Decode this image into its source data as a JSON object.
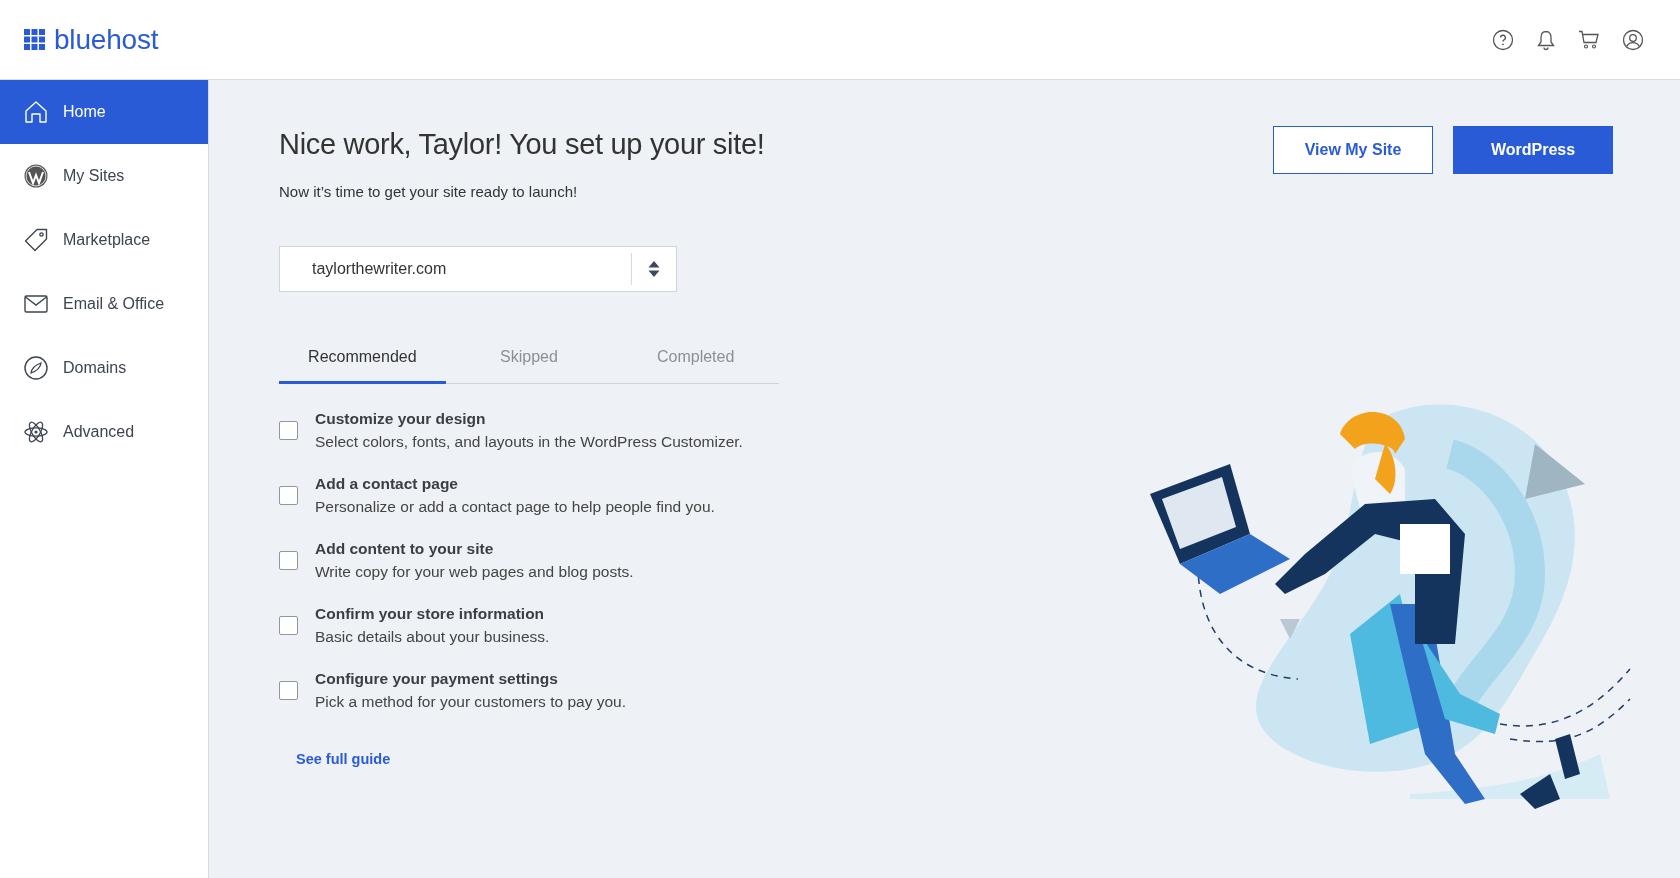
{
  "header": {
    "logo": "bluehost"
  },
  "sidebar": {
    "items": [
      {
        "label": "Home",
        "selected": true
      },
      {
        "label": "My Sites",
        "selected": false
      },
      {
        "label": "Marketplace",
        "selected": false
      },
      {
        "label": "Email & Office",
        "selected": false
      },
      {
        "label": "Domains",
        "selected": false
      },
      {
        "label": "Advanced",
        "selected": false
      }
    ]
  },
  "main": {
    "title": "Nice work, Taylor! You set up your site!",
    "subtitle": "Now it’s time to get your site ready to launch!",
    "buttons": [
      {
        "label": "View My Site",
        "kind": "outline"
      },
      {
        "label": "WordPress",
        "kind": "primary"
      }
    ],
    "site_select": {
      "value": "taylorthewriter.com"
    },
    "tabs": [
      {
        "label": "Recommended",
        "selected": true
      },
      {
        "label": "Skipped",
        "selected": false
      },
      {
        "label": "Completed",
        "selected": false
      }
    ],
    "tasks": [
      {
        "title": "Customize your design",
        "description": "Select colors, fonts, and layouts in the WordPress Customizer.",
        "checked": false
      },
      {
        "title": "Add a contact page",
        "description": "Personalize or add a contact page to help people find you.",
        "checked": false
      },
      {
        "title": "Add content to your site",
        "description": "Write copy for your web pages and blog posts.",
        "checked": false
      },
      {
        "title": "Confirm your store information",
        "description": "Basic details about your business.",
        "checked": false
      },
      {
        "title": "Configure your payment settings",
        "description": "Pick a method for your customers to pay you.",
        "checked": false
      }
    ],
    "guide_link": "See full guide"
  }
}
